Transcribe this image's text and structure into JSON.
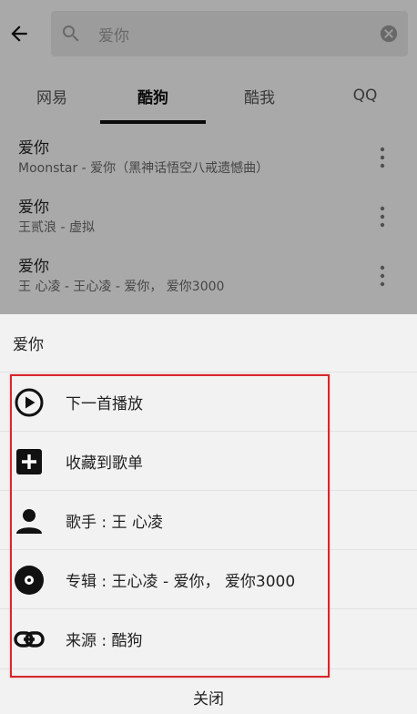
{
  "search": {
    "query": "爱你"
  },
  "tabs": [
    {
      "label": "网易"
    },
    {
      "label": "酷狗"
    },
    {
      "label": "酷我"
    },
    {
      "label": "QQ"
    }
  ],
  "active_tab": "酷狗",
  "songs": [
    {
      "title": "爱你",
      "subtitle": "Moonstar - 爱你（黑神话悟空八戒遗憾曲）"
    },
    {
      "title": "爱你",
      "subtitle": "王贰浪 - 虚拟"
    },
    {
      "title": "爱你",
      "subtitle": "王 心凌 - 王心凌 - 爱你， 爱你3000"
    }
  ],
  "sheet": {
    "title": "爱你",
    "items": [
      {
        "label": "下一首播放",
        "icon": "play-circle-icon"
      },
      {
        "label": "收藏到歌单",
        "icon": "add-box-icon"
      },
      {
        "label": "歌手 : 王 心凌",
        "icon": "person-icon"
      },
      {
        "label": "专辑 : 王心凌 - 爱你， 爱你3000",
        "icon": "album-disc-icon"
      },
      {
        "label": "来源 : 酷狗",
        "icon": "link-icon"
      }
    ],
    "close_label": "关闭"
  },
  "colors": {
    "highlight_border": "#d8262b",
    "overlay": "rgba(0,0,0,0.32)",
    "icon": "#111111"
  }
}
